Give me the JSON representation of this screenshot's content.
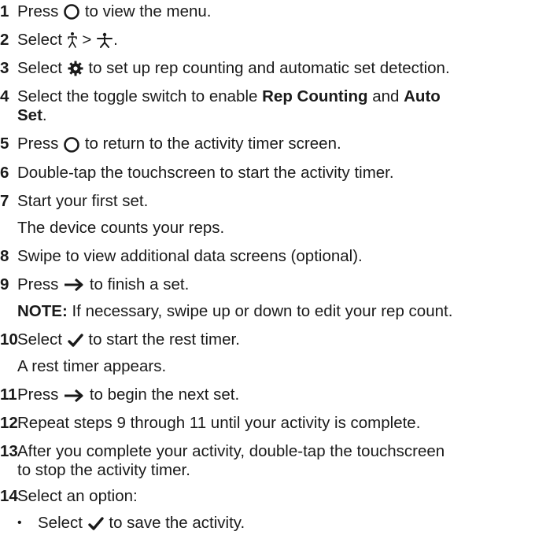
{
  "steps": [
    {
      "num": "1",
      "before": "Press",
      "icon": "circle-button-icon",
      "after": "to view the menu."
    },
    {
      "num": "2",
      "before": "Select",
      "icon": "activity-person-icon",
      "mid": ">",
      "icon2": "strength-icon",
      "after": "."
    },
    {
      "num": "3",
      "before": "Select",
      "icon": "gear-icon",
      "after": "to set up rep counting and automatic set detection."
    },
    {
      "num": "4",
      "before": "Select the toggle switch to enable",
      "b1": "Rep Counting",
      "and": "and",
      "b2a": "Auto",
      "b2b": "Set",
      "after": "."
    },
    {
      "num": "5",
      "before": "Press",
      "icon": "circle-button-icon",
      "after": "to return to the activity timer screen."
    },
    {
      "num": "6",
      "text": "Double-tap the touchscreen to start the activity timer."
    },
    {
      "num": "7",
      "text": "Start your first set.",
      "sub": "The device counts your reps."
    },
    {
      "num": "8",
      "text": "Swipe to view additional data screens (optional)."
    },
    {
      "num": "9",
      "before": "Press",
      "icon": "right-arrow-icon",
      "after": "to finish a set.",
      "note_label": "NOTE:",
      "note": "If necessary, swipe up or down to edit your rep count."
    },
    {
      "num": "10",
      "before": "Select",
      "icon": "checkmark-icon",
      "after": "to start the rest timer.",
      "sub": "A rest timer appears."
    },
    {
      "num": "11",
      "before": "Press",
      "icon": "right-arrow-icon",
      "after": "to begin the next set."
    },
    {
      "num": "12",
      "text": "Repeat steps 9 through 11 until your activity is complete."
    },
    {
      "num": "13",
      "line1": "After you complete your activity, double-tap the touchscreen",
      "line2": "to stop the activity timer."
    },
    {
      "num": "14",
      "text": "Select an option:",
      "bullet": {
        "dot": "•",
        "before": "Select",
        "icon": "checkmark-icon",
        "after": "to save the activity."
      }
    }
  ]
}
